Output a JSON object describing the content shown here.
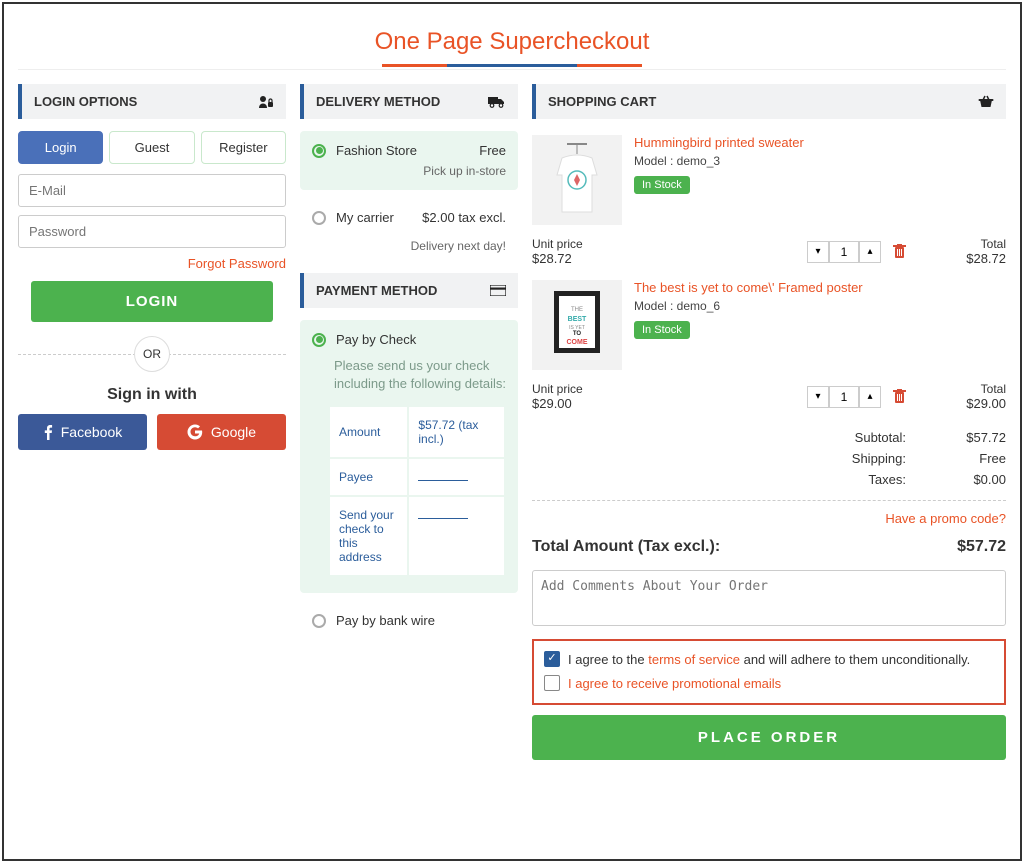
{
  "header": {
    "title": "One Page Supercheckout"
  },
  "login": {
    "panel_title": "LOGIN OPTIONS",
    "tabs": {
      "login": "Login",
      "guest": "Guest",
      "register": "Register"
    },
    "email_placeholder": "E-Mail",
    "password_placeholder": "Password",
    "forgot": "Forgot Password",
    "login_btn": "LOGIN",
    "or": "OR",
    "signin_with": "Sign in with",
    "facebook": "Facebook",
    "google": "Google"
  },
  "delivery": {
    "panel_title": "DELIVERY METHOD",
    "opt1_name": "Fashion Store",
    "opt1_price": "Free",
    "opt1_sub": "Pick up in-store",
    "opt2_name": "My carrier",
    "opt2_price": "$2.00 tax excl.",
    "opt2_sub": "Delivery next day!"
  },
  "payment": {
    "panel_title": "PAYMENT METHOD",
    "opt1_name": "Pay by Check",
    "opt1_desc": "Please send us your check including the following details:",
    "table": {
      "r1c1": "Amount",
      "r1c2": "$57.72 (tax incl.)",
      "r2c1": "Payee",
      "r3c1": "Send your check to this address"
    },
    "opt2_name": "Pay by bank wire"
  },
  "cart": {
    "panel_title": "SHOPPING CART",
    "items": [
      {
        "title": "Hummingbird printed sweater",
        "model": "Model : demo_3",
        "stock": "In Stock",
        "unit_label": "Unit price",
        "unit_value": "$28.72",
        "qty": "1",
        "total_label": "Total",
        "total_value": "$28.72"
      },
      {
        "title": "The best is yet to come\\' Framed poster",
        "model": "Model : demo_6",
        "stock": "In Stock",
        "unit_label": "Unit price",
        "unit_value": "$29.00",
        "qty": "1",
        "total_label": "Total",
        "total_value": "$29.00"
      }
    ],
    "summary": {
      "subtotal_label": "Subtotal:",
      "subtotal_value": "$57.72",
      "shipping_label": "Shipping:",
      "shipping_value": "Free",
      "taxes_label": "Taxes:",
      "taxes_value": "$0.00"
    },
    "promo": "Have a promo code?",
    "total_label": "Total Amount (Tax excl.):",
    "total_value": "$57.72",
    "comment_placeholder": "Add Comments About Your Order",
    "agree1_pre": "I agree to the ",
    "agree1_link": "terms of service",
    "agree1_post": " and will adhere to them unconditionally.",
    "agree2": "I agree to receive promotional emails",
    "place_order": "PLACE ORDER"
  }
}
